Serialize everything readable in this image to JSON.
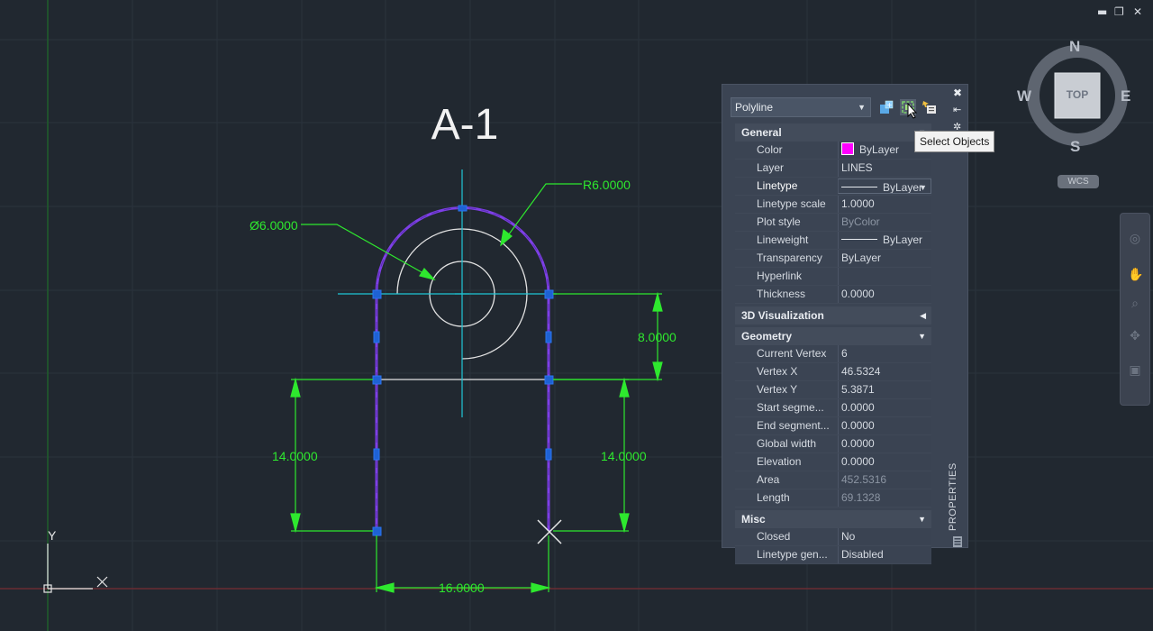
{
  "window": {
    "minimize": "▬",
    "restore": "❐",
    "close": "✕"
  },
  "drawing": {
    "title": "A-1",
    "dim_diameter": "Ø6.0000",
    "dim_radius": "R6.0000",
    "dim_vertical_right_top": "8.0000",
    "dim_vertical_left": "14.0000",
    "dim_vertical_right": "14.0000",
    "dim_horizontal_bottom": "16.0000",
    "ucs_x": "X",
    "ucs_y": "Y",
    "colors": {
      "background": "#212830",
      "polyline": "#7b3fe0",
      "dimension": "#2ee82e",
      "centerline": "#20c8d8",
      "geometry": "#e8e8e8",
      "grip": "#1e5fd0"
    }
  },
  "properties": {
    "object_type": "Polyline",
    "toolbar_icons": [
      "quick-select-icon",
      "select-objects-icon",
      "pickadd-icon"
    ],
    "tooltip": "Select Objects",
    "palette_title": "PROPERTIES",
    "categories": [
      {
        "name": "General",
        "rows": [
          {
            "key": "Color",
            "value": "ByLayer"
          },
          {
            "key": "Layer",
            "value": "LINES"
          },
          {
            "key": "Linetype",
            "value": "ByLayer"
          },
          {
            "key": "Linetype scale",
            "value": "1.0000"
          },
          {
            "key": "Plot style",
            "value": "ByColor"
          },
          {
            "key": "Lineweight",
            "value": "ByLayer"
          },
          {
            "key": "Transparency",
            "value": "ByLayer"
          },
          {
            "key": "Hyperlink",
            "value": ""
          },
          {
            "key": "Thickness",
            "value": "0.0000"
          }
        ]
      },
      {
        "name": "3D Visualization",
        "rows": []
      },
      {
        "name": "Geometry",
        "rows": [
          {
            "key": "Current Vertex",
            "value": "6"
          },
          {
            "key": "Vertex X",
            "value": "46.5324"
          },
          {
            "key": "Vertex Y",
            "value": "5.3871"
          },
          {
            "key": "Start  segme...",
            "value": "0.0000"
          },
          {
            "key": "End  segment...",
            "value": "0.0000"
          },
          {
            "key": "Global width",
            "value": "0.0000"
          },
          {
            "key": "Elevation",
            "value": "0.0000"
          },
          {
            "key": "Area",
            "value": "452.5316"
          },
          {
            "key": "Length",
            "value": "69.1328"
          }
        ]
      },
      {
        "name": "Misc",
        "rows": [
          {
            "key": "Closed",
            "value": "No"
          },
          {
            "key": "Linetype gen...",
            "value": "Disabled"
          }
        ]
      }
    ]
  },
  "viewcube": {
    "n": "N",
    "s": "S",
    "e": "E",
    "w": "W",
    "face": "TOP",
    "wcs": "WCS"
  }
}
